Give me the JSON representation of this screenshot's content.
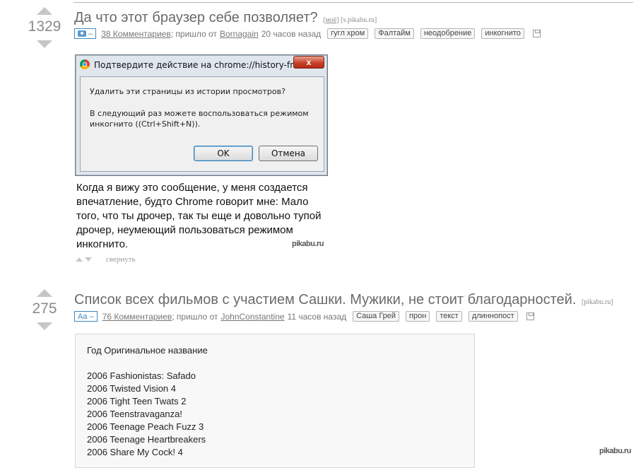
{
  "stories": [
    {
      "score": "1329",
      "title": "Да что этот браузер себе позволяет?",
      "source_mine": "моё",
      "source_site": "[s.pikabu.ru]",
      "type_label": "–",
      "comments": "38 Комментариев",
      "posted_from": "; пришло от",
      "author": "Bornagain",
      "time_ago": "20 часов назад",
      "tags": [
        "гугл хром",
        "Фалтайм",
        "неодобрение",
        "инкогнито"
      ]
    },
    {
      "score": "275",
      "title": "Список всех фильмов с участием Сашки. Мужики, не стоит благодарностей.",
      "source_site": "[pikabu.ru]",
      "type_label": "Aa –",
      "comments": "76 Комментариев",
      "posted_from": "; пришло от",
      "author": "JohnConstantine",
      "time_ago": "11 часов назад",
      "tags": [
        "Саша Грей",
        "прон",
        "текст",
        "длиннопост"
      ]
    }
  ],
  "dialog": {
    "title": "Подтвердите действие на chrome://history-frame",
    "close": "x",
    "question": "Удалить эти страницы из истории просмотров?",
    "message": "В следующий раз можете воспользоваться режимом\nинкогнито ((Ctrl+Shift+N)).",
    "ok": "OK",
    "cancel": "Отмена"
  },
  "caption": "Когда я вижу это сообщение, у меня создается впечатление, будто Chrome говорит мне: Мало того, что ты дрочер, так ты еще и довольно тупой дрочер, неумеющий пользоваться режимом инкогнито.",
  "watermark": "pikabu.ru",
  "collapse_label": "свернуть",
  "film_list": {
    "header": "Год Оригинальное название",
    "items": [
      "2006 Fashionistas: Safado",
      "2006 Twisted Vision 4",
      "2006 Tight Teen Twats 2",
      "2006 Teenstravaganza!",
      "2006 Teenage Peach Fuzz 3",
      "2006 Teenage Heartbreakers",
      "2006 Share My Cock! 4"
    ]
  }
}
